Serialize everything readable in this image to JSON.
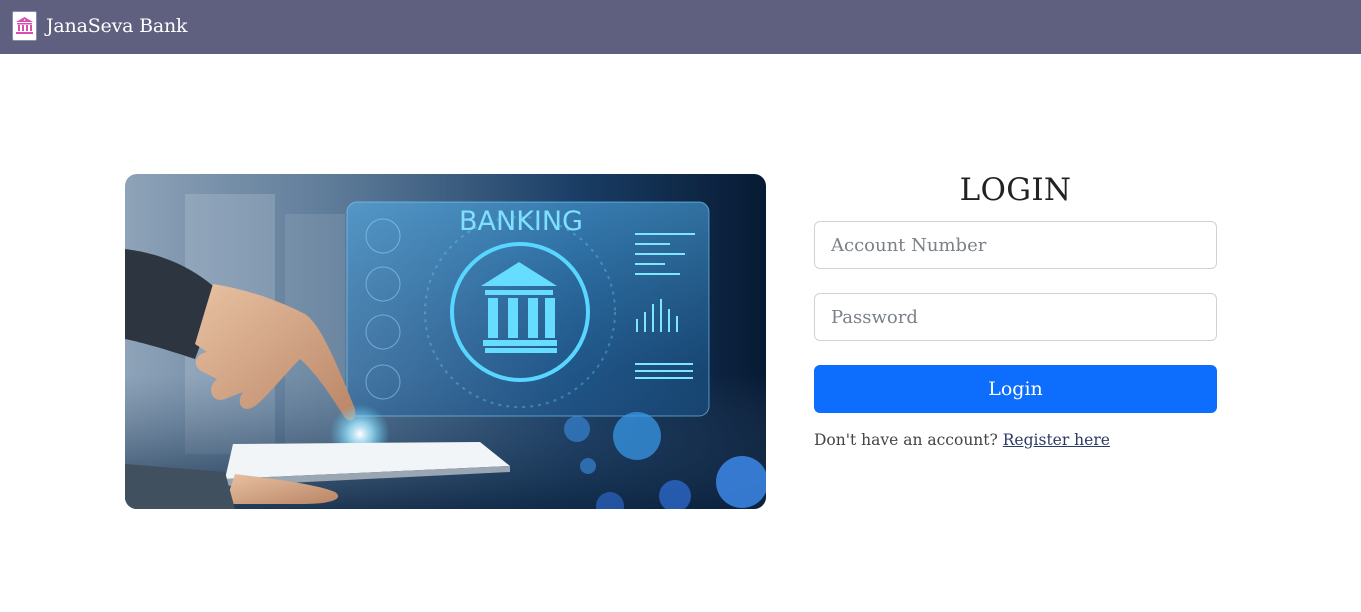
{
  "navbar": {
    "brand_name": "JanaSeva Bank",
    "background": "#5f6080",
    "logo_icon": "bank-building-icon"
  },
  "hero": {
    "image_text": "BANKING",
    "image_subject": "hand-tapping-tablet-with-bank-hologram"
  },
  "login": {
    "title": "LOGIN",
    "account_placeholder": "Account Number",
    "password_placeholder": "Password",
    "button_label": "Login",
    "button_color": "#0d6efd",
    "register_prompt": "Don't have an account?",
    "register_link": "Register here"
  }
}
